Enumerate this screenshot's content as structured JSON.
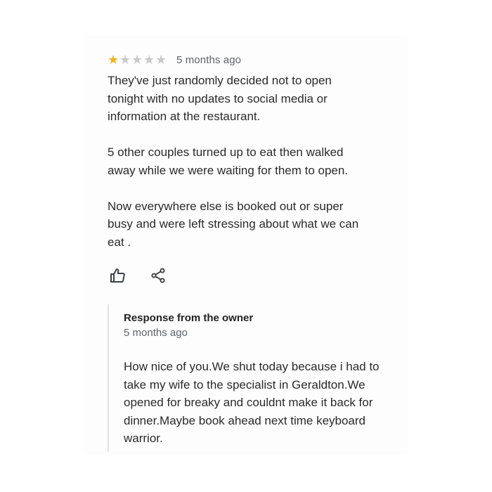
{
  "review": {
    "rating": 1,
    "max_rating": 5,
    "star_color": "#f2b01e",
    "time_ago": "5 months ago",
    "paragraphs": [
      "They've just randomly decided not to open\ntonight with no updates to social media or\ninformation at the restaurant.",
      "5 other couples turned up to eat then walked\naway while we were waiting for them to open.",
      "Now everywhere else is booked out or super\nbusy and were left stressing about what we can\neat ."
    ]
  },
  "actions": {
    "like_icon": "thumbs-up-icon",
    "share_icon": "share-icon"
  },
  "owner_response": {
    "title": "Response from the owner",
    "time_ago": "5 months ago",
    "text": "How nice of you.We shut today because i had to\ntake my wife to the specialist in Geraldton.We\nopened for breaky and couldnt make it back for\ndinner.Maybe book ahead next time keyboard\nwarrior."
  }
}
